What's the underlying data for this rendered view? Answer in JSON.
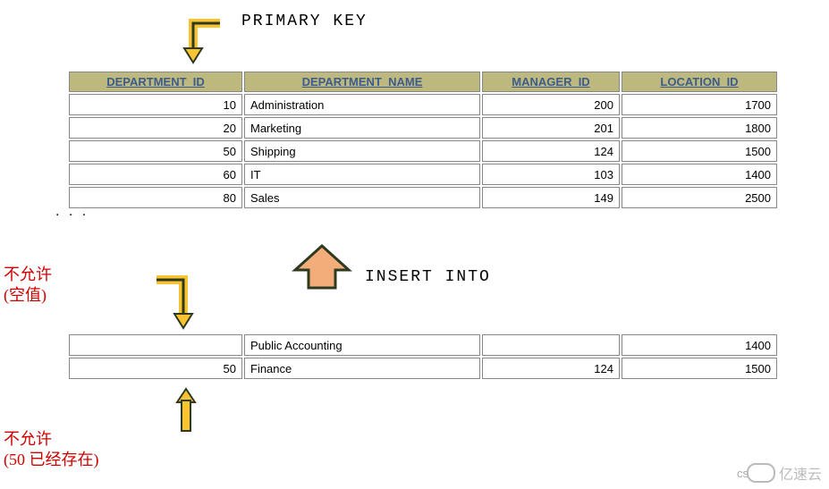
{
  "labels": {
    "primary_key": "PRIMARY KEY",
    "insert_into": "INSERT INTO",
    "not_allowed_null_l1": "不允许",
    "not_allowed_null_l2": "(空值)",
    "not_allowed_dup_l1": "不允许",
    "not_allowed_dup_l2": "(50 已经存在)",
    "ellipsis": ". . .",
    "watermark": "亿速云",
    "cs": "cs"
  },
  "table1": {
    "headers": [
      "DEPARTMENT_ID",
      "DEPARTMENT_NAME",
      "MANAGER_ID",
      "LOCATION_ID"
    ],
    "rows": [
      {
        "id": "10",
        "name": "Administration",
        "mgr": "200",
        "loc": "1700"
      },
      {
        "id": "20",
        "name": "Marketing",
        "mgr": "201",
        "loc": "1800"
      },
      {
        "id": "50",
        "name": "Shipping",
        "mgr": "124",
        "loc": "1500"
      },
      {
        "id": "60",
        "name": "IT",
        "mgr": "103",
        "loc": "1400"
      },
      {
        "id": "80",
        "name": "Sales",
        "mgr": "149",
        "loc": "2500"
      }
    ]
  },
  "table2": {
    "rows": [
      {
        "id": "",
        "name": "Public Accounting",
        "mgr": "",
        "loc": "1400"
      },
      {
        "id": "50",
        "name": "Finance",
        "mgr": "124",
        "loc": "1500"
      }
    ]
  },
  "colors": {
    "header_bg": "#bcb87e",
    "header_fg": "#3d5c8c",
    "arrow_fill": "#f9c430",
    "arrow_stroke": "#2e3a1f",
    "big_arrow_fill": "#f3ad7a",
    "red": "#d00000"
  },
  "chart_data": {
    "type": "table",
    "title": "PRIMARY KEY constraint illustration on DEPARTMENTS table",
    "columns": [
      "DEPARTMENT_ID",
      "DEPARTMENT_NAME",
      "MANAGER_ID",
      "LOCATION_ID"
    ],
    "primary_key": "DEPARTMENT_ID",
    "existing_rows": [
      [
        10,
        "Administration",
        200,
        1700
      ],
      [
        20,
        "Marketing",
        201,
        1800
      ],
      [
        50,
        "Shipping",
        124,
        1500
      ],
      [
        60,
        "IT",
        103,
        1400
      ],
      [
        80,
        "Sales",
        149,
        2500
      ]
    ],
    "attempted_inserts": [
      {
        "row": [
          null,
          "Public Accounting",
          null,
          1400
        ],
        "rejected_reason": "null primary key"
      },
      {
        "row": [
          50,
          "Finance",
          124,
          1500
        ],
        "rejected_reason": "duplicate primary key 50"
      }
    ]
  }
}
